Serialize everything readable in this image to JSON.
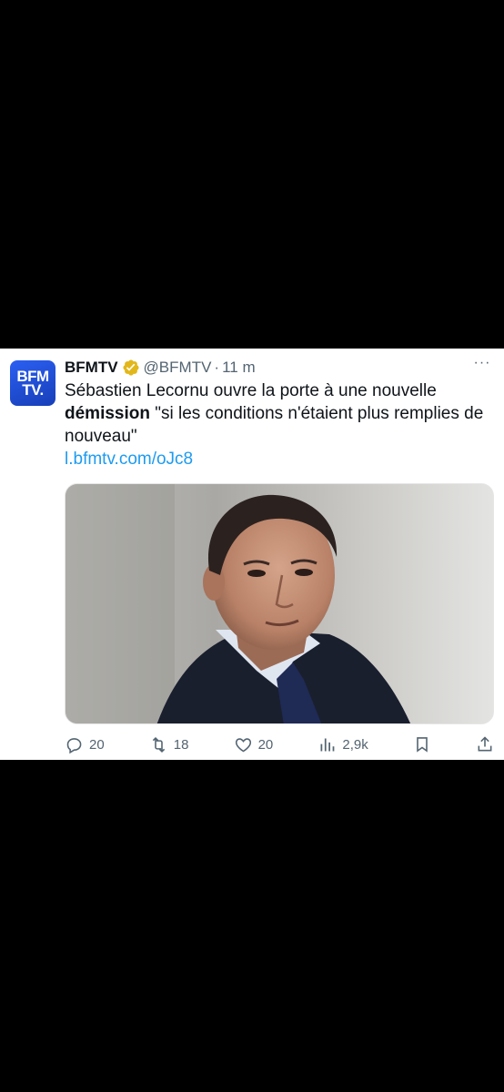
{
  "tweet": {
    "avatar_text_line1": "BFM",
    "avatar_text_line2": "TV.",
    "display_name": "BFMTV",
    "handle": "@BFMTV",
    "separator": "·",
    "time": "11 m",
    "text_part1": "Sébastien Lecornu ouvre la porte à une nouvelle ",
    "text_bold": "démission",
    "text_part2": " \"si les conditions n'étaient plus remplies de nouveau\"",
    "link": "l.bfmtv.com/oJc8",
    "more_label": "···"
  },
  "actions": {
    "replies": "20",
    "retweets": "18",
    "likes": "20",
    "views": "2,9k"
  },
  "colors": {
    "accent": "#1d9bf0",
    "secondary_text": "#536471",
    "verified": "#e2b719",
    "avatar": "#2254e6"
  },
  "icons": [
    "verified-badge-icon",
    "more-icon",
    "reply-icon",
    "retweet-icon",
    "like-icon",
    "views-icon",
    "bookmark-icon",
    "share-icon"
  ]
}
